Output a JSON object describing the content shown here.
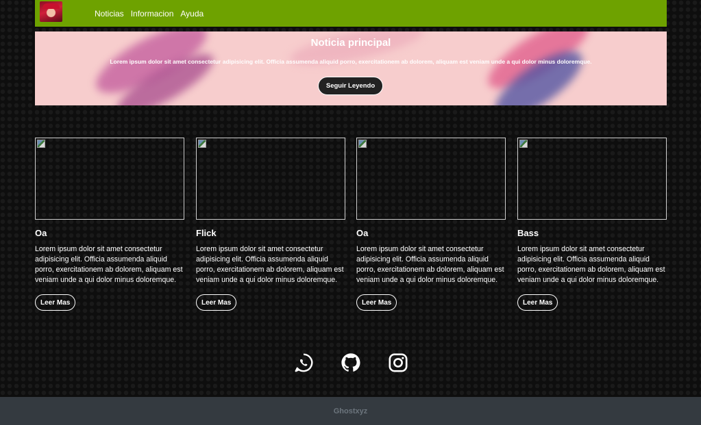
{
  "navbar": {
    "logo_icon": "anime-avatar-logo",
    "links": [
      "Noticias",
      "Informacion",
      "Ayuda"
    ],
    "background": "#6ea200"
  },
  "hero": {
    "title": "Noticia principal",
    "text": "Lorem ipsum dolor sit amet consectetur adipisicing elit. Officia assumenda aliquid porro, exercitationem ab dolorem, aliquam est veniam unde a qui dolor minus doloremque.",
    "button_label": "Seguir Leyendo",
    "background": "#f7cdcd"
  },
  "cards": [
    {
      "image_icon": "broken-image-icon",
      "title": "Oa",
      "text": "Lorem ipsum dolor sit amet consectetur adipisicing elit. Officia assumenda aliquid porro, exercitationem ab dolorem, aliquam est veniam unde a qui dolor minus doloremque.",
      "button_label": "Leer Mas"
    },
    {
      "image_icon": "broken-image-icon",
      "title": "Flick",
      "text": "Lorem ipsum dolor sit amet consectetur adipisicing elit. Officia assumenda aliquid porro, exercitationem ab dolorem, aliquam est veniam unde a qui dolor minus doloremque.",
      "button_label": "Leer Mas"
    },
    {
      "image_icon": "broken-image-icon",
      "title": "Oa",
      "text": "Lorem ipsum dolor sit amet consectetur adipisicing elit. Officia assumenda aliquid porro, exercitationem ab dolorem, aliquam est veniam unde a qui dolor minus doloremque.",
      "button_label": "Leer Mas"
    },
    {
      "image_icon": "broken-image-icon",
      "title": "Bass",
      "text": "Lorem ipsum dolor sit amet consectetur adipisicing elit. Officia assumenda aliquid porro, exercitationem ab dolorem, aliquam est veniam unde a qui dolor minus doloremque.",
      "button_label": "Leer Mas"
    }
  ],
  "social": {
    "icons": [
      "whatsapp-icon",
      "github-icon",
      "instagram-icon"
    ]
  },
  "footer": {
    "text": "Ghostxyz",
    "background": "#343a40"
  }
}
